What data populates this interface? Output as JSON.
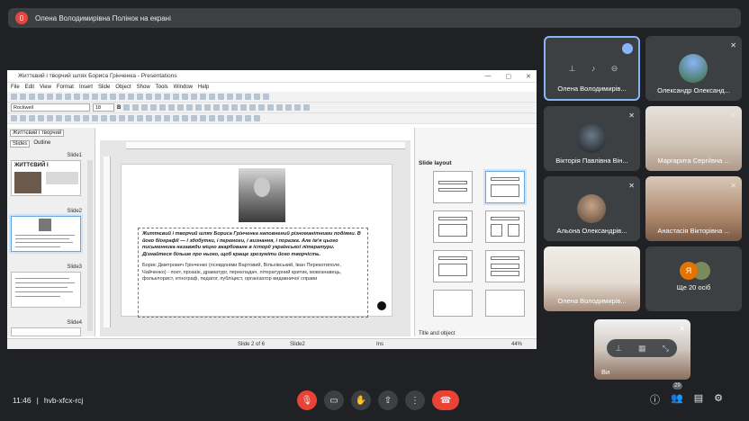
{
  "banner": {
    "badge": "0",
    "text": "Олена Володимирівна Полінок на екрані"
  },
  "shared": {
    "window_title": "Життєвий і творчий шлях Бориса Грінченка - Presentations",
    "menu": [
      "File",
      "Edit",
      "View",
      "Format",
      "Insert",
      "Slide",
      "Object",
      "Show",
      "Tools",
      "Window",
      "Help"
    ],
    "font_name": "Rockwell",
    "font_size": "18",
    "panel_tabs": [
      "Slides",
      "Outline"
    ],
    "doc_tab": "Життєвий і творчий",
    "slides": [
      {
        "label": "Slide1",
        "thumb_title": "ЖИТТЄВИЙ І"
      },
      {
        "label": "Slide2"
      },
      {
        "label": "Slide3"
      },
      {
        "label": "Slide4"
      }
    ],
    "slide_text_bold": "Життєвий і творчий шлях Бориса Грінченка наповнений різноманітними подіями. В його біографії — і здобутки, і перемоги, і визнання, і поразка. Але ім'я цього письменника назавжди міцно вкарбоване в історії української літератури. Дізнайтеся більше про нього, щоб краще зрозуміти його творчість.",
    "slide_text_normal": "Борис Дмитрович Грінченко (псевдоніми Вартовий, Вільхівський, Іван Перекотиполе, Чайченко) - поет, прозаїк, драматург, перекладач, літературний критик, мовознавець, фольклорист, етнограф, педагог, публіцист, організатор видавничої справи",
    "layout_panel_title": "Slide layout",
    "layout_footer": "Title and object",
    "status": {
      "slide": "Slide 2 of 6",
      "layout": "Slide2",
      "mode": "Ins",
      "zoom": "44%"
    }
  },
  "participants": [
    {
      "name": "Олена Володимирів..."
    },
    {
      "name": "Олександр Олександ..."
    },
    {
      "name": "Вікторія Павлівна Він..."
    },
    {
      "name": "Маргарита Сергіївна ..."
    },
    {
      "name": "Альона Олександрів..."
    },
    {
      "name": "Анастасія Вікторівна ..."
    },
    {
      "name": "Олена Володимирів..."
    },
    {
      "name": "Ще 20 осіб",
      "avatar_letter": "Я"
    }
  ],
  "self_label": "Ви",
  "bottom": {
    "time": "11:46",
    "code": "hvb-xfcx-rcj",
    "people_count": "29"
  }
}
